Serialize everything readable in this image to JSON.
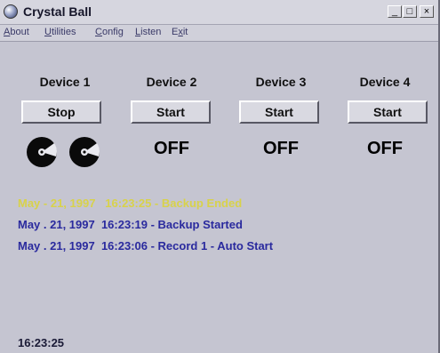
{
  "window": {
    "title": "Crystal Ball"
  },
  "title_buttons": {
    "minimize": "_",
    "maximize": "□",
    "close": "×"
  },
  "menu": [
    {
      "label": "About",
      "accel_index": 0
    },
    {
      "label": "Utilities",
      "accel_index": 0
    },
    {
      "label": "Config",
      "accel_index": 0
    },
    {
      "label": "Listen",
      "accel_index": 0
    },
    {
      "label": "Exit",
      "accel_index": 1
    }
  ],
  "devices": [
    {
      "label": "Device 1",
      "button": "Stop",
      "status": "",
      "recording": true
    },
    {
      "label": "Device 2",
      "button": "Start",
      "status": "OFF",
      "recording": false
    },
    {
      "label": "Device 3",
      "button": "Start",
      "status": "OFF",
      "recording": false
    },
    {
      "label": "Device 4",
      "button": "Start",
      "status": "OFF",
      "recording": false
    }
  ],
  "log": [
    {
      "text": "May - 21, 1997   16:23:25 - Backup Ended",
      "highlight": true,
      "color": "#d8d24a"
    },
    {
      "text": "May . 21, 1997  16:23:19 - Backup Started",
      "highlight": false,
      "color": "#2a2a9e"
    },
    {
      "text": "May . 21, 1997  16:23:06 - Record 1 - Auto Start",
      "highlight": false,
      "color": "#2a2a9e"
    }
  ],
  "clock": "16:23:25",
  "icons": {
    "app": "crystal-ball-icon",
    "reel": "tape-reel-icon"
  }
}
